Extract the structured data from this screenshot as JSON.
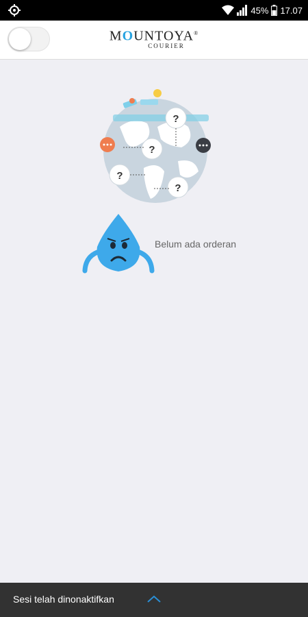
{
  "status_bar": {
    "battery_percent": "45%",
    "time": "17.07"
  },
  "header": {
    "brand_name_1": "M",
    "brand_name_o": "O",
    "brand_name_2": "UNTOYA",
    "brand_registered": "®",
    "brand_sub": "COURIER",
    "toggle_on": false
  },
  "main": {
    "empty_message": "Belum ada orderan"
  },
  "snackbar": {
    "message": "Sesi telah dinonaktifkan"
  },
  "colors": {
    "accent": "#29a3e0",
    "background": "#efeff4",
    "snackbar": "#323232"
  }
}
